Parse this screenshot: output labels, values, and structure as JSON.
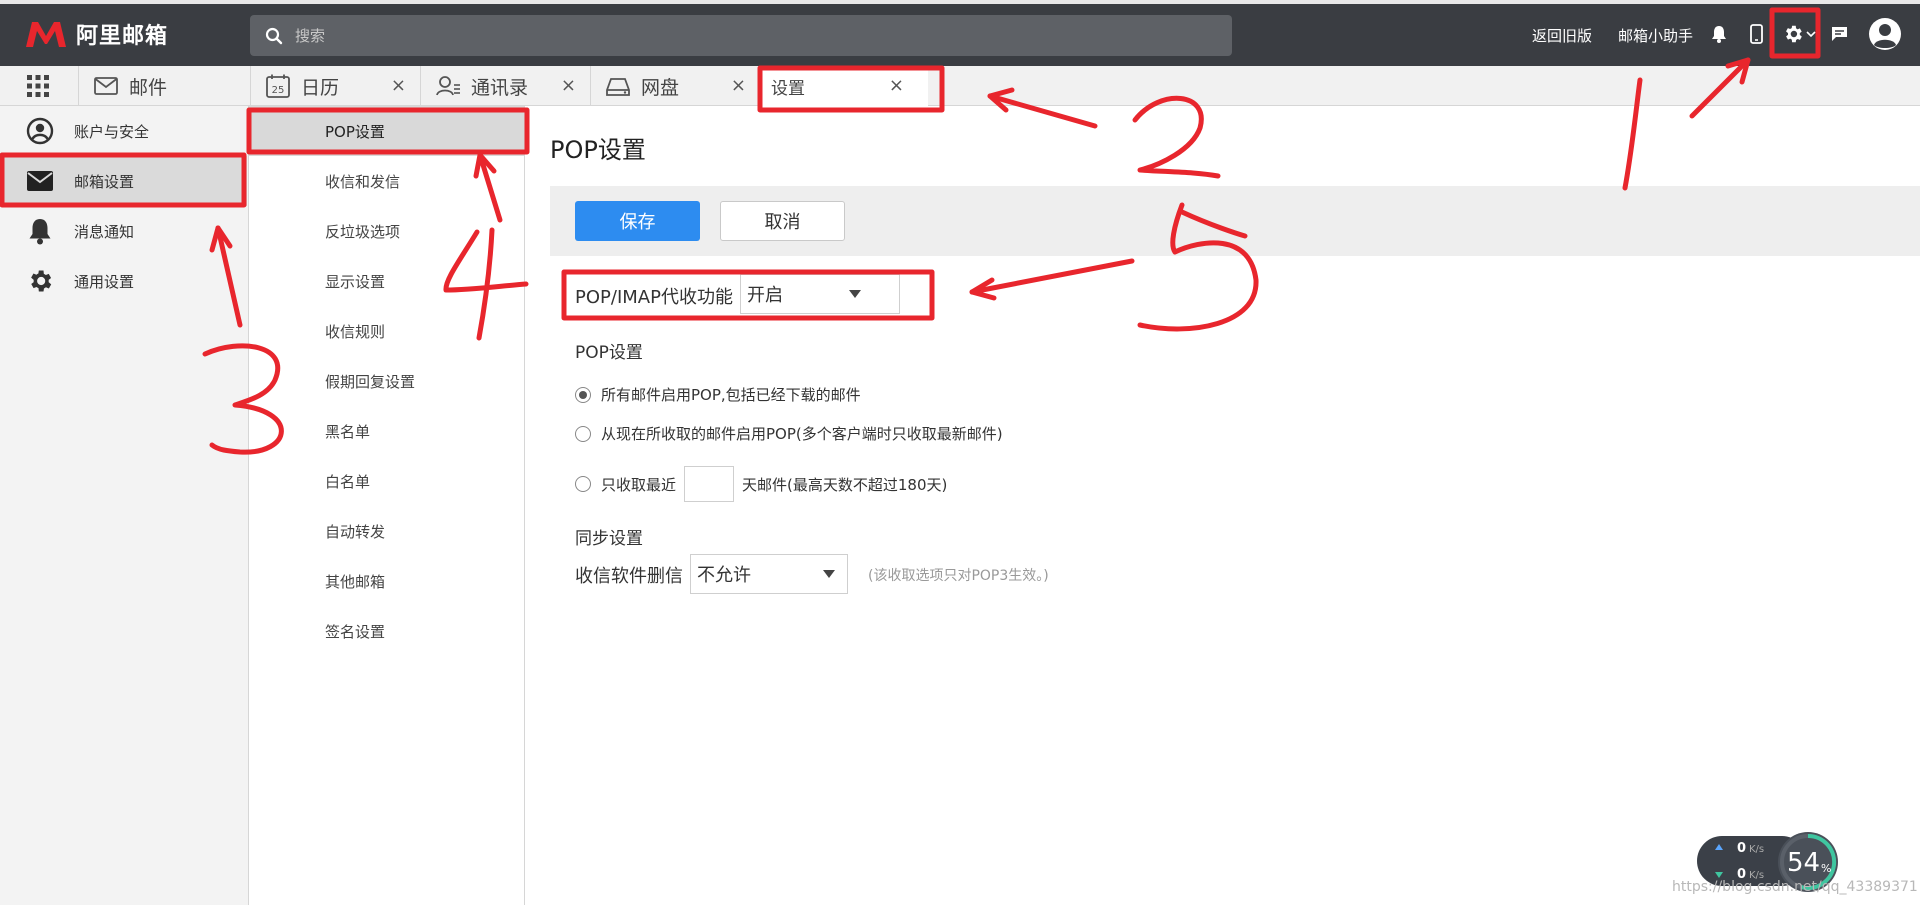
{
  "header": {
    "logo_text": "阿里邮箱",
    "search_placeholder": "搜索",
    "back_old_version": "返回旧版",
    "assistant": "邮箱小助手"
  },
  "tabs": [
    {
      "label": "邮件",
      "icon": "envelope-icon"
    },
    {
      "label": "日历",
      "icon": "calendar-icon",
      "badge": "25",
      "close": "×"
    },
    {
      "label": "通讯录",
      "icon": "contacts-icon",
      "close": "×"
    },
    {
      "label": "网盘",
      "icon": "drive-icon",
      "close": "×"
    },
    {
      "label": "设置",
      "close": "×",
      "active": true
    }
  ],
  "sidebar": {
    "items": [
      {
        "label": "账户与安全",
        "icon": "user-circle-icon"
      },
      {
        "label": "邮箱设置",
        "icon": "envelope-icon",
        "active": true
      },
      {
        "label": "消息通知",
        "icon": "bell-icon"
      },
      {
        "label": "通用设置",
        "icon": "gear-icon"
      }
    ]
  },
  "submenu": {
    "items": [
      "POP设置",
      "收信和发信",
      "反垃圾选项",
      "显示设置",
      "收信规则",
      "假期回复设置",
      "黑名单",
      "白名单",
      "自动转发",
      "其他邮箱",
      "签名设置"
    ],
    "active_index": 0
  },
  "main": {
    "title": "POP设置",
    "save_label": "保存",
    "cancel_label": "取消",
    "pop_imap_label": "POP/IMAP代收功能",
    "pop_imap_value": "开启",
    "pop_section_title": "POP设置",
    "radio_options": [
      {
        "label": "所有邮件启用POP,包括已经下载的邮件",
        "checked": true
      },
      {
        "label": "从现在所收取的邮件启用POP(多个客户端时只收取最新邮件)",
        "checked": false
      },
      {
        "label_before": "只收取最近",
        "label_after": "天邮件(最高天数不超过180天)",
        "checked": false,
        "days_value": ""
      }
    ],
    "sync_section_title": "同步设置",
    "delete_label": "收信软件删信",
    "delete_value": "不允许",
    "delete_hint": "(该收取选项只对POP3生效。)"
  },
  "widget": {
    "up_speed": "0",
    "down_speed": "0",
    "speed_unit": "K/s",
    "percent": "54",
    "percent_unit": "%"
  },
  "watermark": "https://blog.csdn.net/qq_43389371",
  "annotations": [
    "1",
    "2",
    "3",
    "4",
    "5"
  ],
  "colors": {
    "header_bg": "#3a3d42",
    "primary": "#2d8cf0",
    "annotation_red": "#e8262d",
    "logo_red": "#e8262d"
  }
}
